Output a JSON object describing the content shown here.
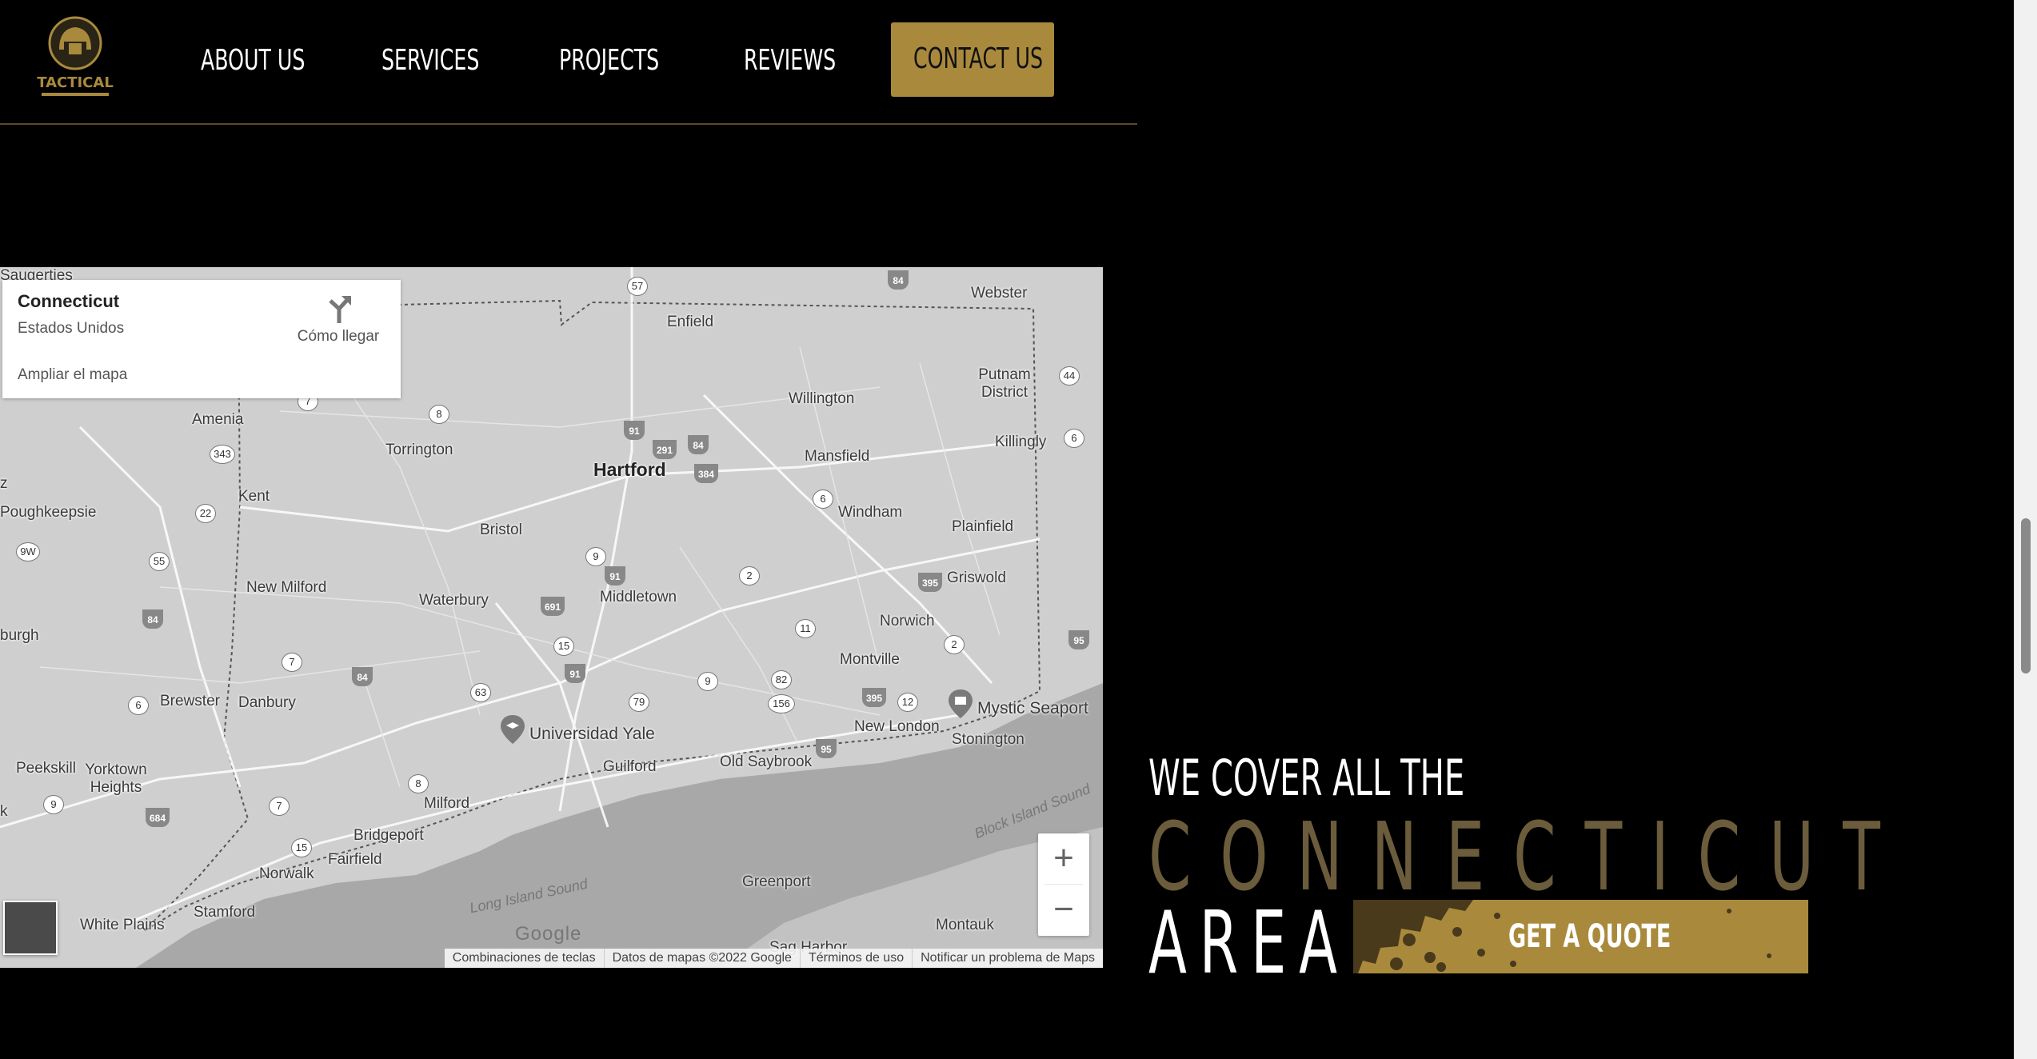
{
  "colors": {
    "accent_gold": "#a98a3d",
    "state_text": "#6b5c3c",
    "background": "#000000"
  },
  "logo": {
    "text": "TACTICAL"
  },
  "nav": {
    "items": [
      {
        "label": "ABOUT US"
      },
      {
        "label": "SERVICES"
      },
      {
        "label": "PROJECTS"
      },
      {
        "label": "REVIEWS"
      }
    ],
    "contact_label": "CONTACT US"
  },
  "map": {
    "info_card": {
      "title": "Connecticut",
      "subtitle": "Estados Unidos",
      "directions_label": "Cómo llegar",
      "enlarge_link": "Ampliar el mapa"
    },
    "places": [
      "Saugerties",
      "Enfield",
      "Webster",
      "Putnam District",
      "Willington",
      "Killingly",
      "Amenia",
      "Torrington",
      "Hartford",
      "Mansfield",
      "Kent",
      "Poughkeepsie",
      "Bristol",
      "Windham",
      "Plainfield",
      "Griswold",
      "New Milford",
      "Waterbury",
      "Middletown",
      "Norwich",
      "burgh",
      "Montville",
      "Brewster",
      "Danbury",
      "Mystic Seaport",
      "Universidad Yale",
      "New London",
      "Stonington",
      "Guilford",
      "Old Saybrook",
      "Peekskill",
      "Yorktown Heights",
      "Milford",
      "Bridgeport",
      "Fairfield",
      "Norwalk",
      "Greenport",
      "Stamford",
      "White Plains",
      "Montauk",
      "Sag Harbor",
      "z",
      "k"
    ],
    "water_labels": [
      "Long Island Sound",
      "Block Island Sound"
    ],
    "route_shields": [
      "57",
      "84",
      "44",
      "8",
      "7",
      "343",
      "22",
      "91",
      "291",
      "84",
      "384",
      "6",
      "6",
      "9W",
      "55",
      "9",
      "2",
      "691",
      "91",
      "395",
      "84",
      "11",
      "2",
      "95",
      "15",
      "7",
      "84",
      "9",
      "82",
      "63",
      "91",
      "79",
      "156",
      "395",
      "12",
      "6",
      "95",
      "8",
      "7",
      "9",
      "684",
      "15"
    ],
    "google_logo": "Google",
    "zoom_in": "+",
    "zoom_out": "−",
    "footer": {
      "shortcuts": "Combinaciones de teclas",
      "map_data": "Datos de mapas ©2022 Google",
      "terms": "Términos de uso",
      "report": "Notificar un problema de Maps"
    }
  },
  "cover": {
    "line1": "WE COVER ALL THE",
    "state": "CONNECTICUT",
    "area": "AREA",
    "quote_button": "GET A QUOTE"
  }
}
